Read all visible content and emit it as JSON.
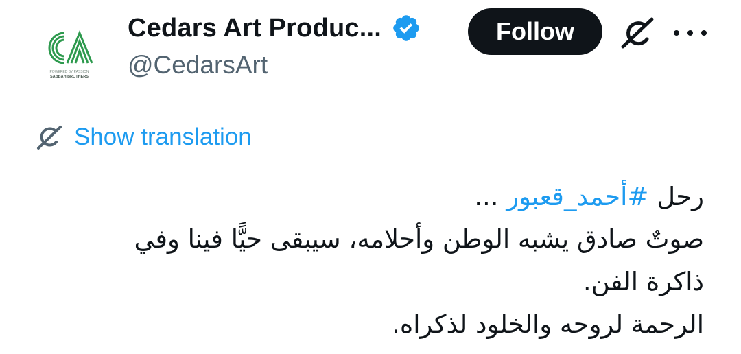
{
  "account": {
    "display_name": "Cedars Art Produc...",
    "handle": "@CedarsArt",
    "verified": true,
    "avatar_logo_text": "CA",
    "avatar_tagline": "POWERED BY PASSION",
    "avatar_subtitle": "SABBAH BROTHERS"
  },
  "actions": {
    "follow_label": "Follow",
    "grok_icon": "grok-icon",
    "more_icon": "more-icon"
  },
  "translation": {
    "label": "Show translation",
    "icon": "translate-icon"
  },
  "tweet": {
    "line1_prefix": "رحل ",
    "hashtag": "#أحمد_قعبور",
    "line1_suffix": " ...",
    "line2": "صوتٌ صادق يشبه الوطن وأحلامه، سيبقى حيًّا فينا وفي",
    "line3": "ذاكرة الفن.",
    "line4": "الرحمة لروحه والخلود لذكراه."
  },
  "colors": {
    "accent": "#1d9bf0",
    "text": "#0f1419",
    "muted": "#536471",
    "brand_green": "#2e9a4e",
    "button_bg": "#0f1419"
  }
}
